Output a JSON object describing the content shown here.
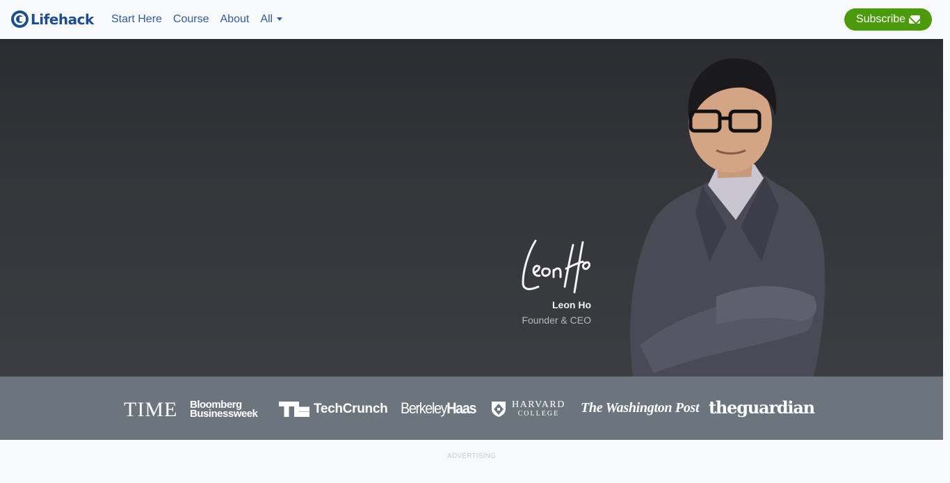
{
  "brand": {
    "name": "Lifehack",
    "icon": "lifehack-logo-icon",
    "color": "#1f4e8c"
  },
  "nav": {
    "items": [
      {
        "label": "Start Here"
      },
      {
        "label": "Course"
      },
      {
        "label": "About"
      },
      {
        "label": "All"
      }
    ],
    "subscribe_label": "Subscribe",
    "subscribe_icon": "envelope-icon",
    "link_color": "#2e5d9a",
    "subscribe_color": "#4a9a0c"
  },
  "hero": {
    "person_name": "Leon Ho",
    "person_title": "Founder & CEO",
    "signature_text": "Leon Ho"
  },
  "press": {
    "logos": [
      {
        "text": "TIME"
      },
      {
        "line1": "Bloomberg",
        "line2": "Businessweek"
      },
      {
        "text": "TechCrunch"
      },
      {
        "part1": "Berkeley",
        "part2": "Haas"
      },
      {
        "line1": "HARVARD",
        "line2": "COLLEGE"
      },
      {
        "text": "The Washington Post"
      },
      {
        "text": "theguardian"
      }
    ]
  },
  "ad": {
    "label": "ADVERTISING"
  }
}
